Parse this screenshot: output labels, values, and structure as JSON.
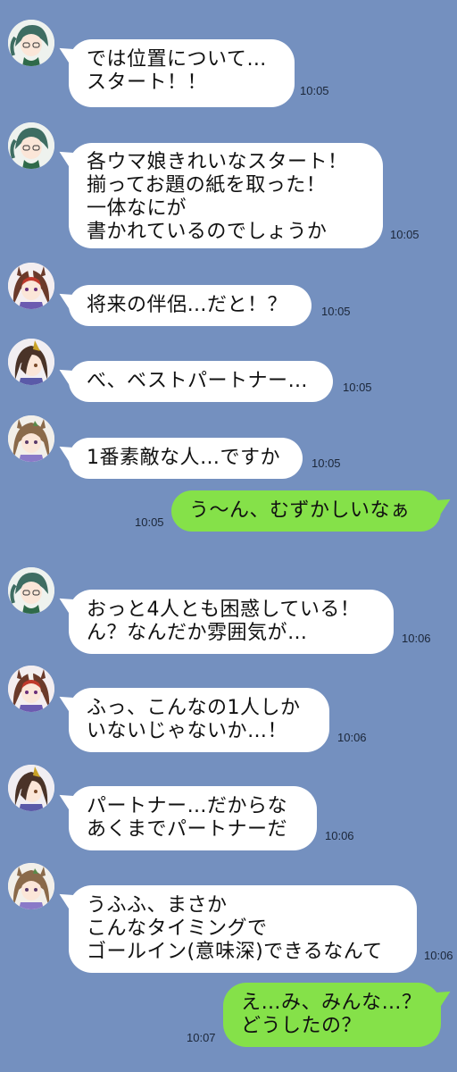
{
  "theme": {
    "background": "#7490bf",
    "incoming_bubble": "#ffffff",
    "outgoing_bubble": "#85e149"
  },
  "messages": [
    {
      "sender": "green-hair-glasses-avatar",
      "direction": "in",
      "text": "では位置について…\nスタート！！",
      "time": "10:05"
    },
    {
      "sender": "green-hair-glasses-avatar",
      "direction": "in",
      "text": "各ウマ娘きれいなスタート！\n揃ってお題の紙を取った！\n一体なにが\n書かれているのでしょうか",
      "time": "10:05"
    },
    {
      "sender": "red-streak-horse-girl-avatar",
      "direction": "in",
      "text": "将来の伴侶…だと！？",
      "time": "10:05"
    },
    {
      "sender": "brown-hair-horse-girl-avatar",
      "direction": "in",
      "text": "べ、ベストパートナー…",
      "time": "10:05"
    },
    {
      "sender": "long-hair-horse-girl-avatar",
      "direction": "in",
      "text": "1番素敵な人…ですか",
      "time": "10:05"
    },
    {
      "sender": "self",
      "direction": "out",
      "text": "う～ん、むずかしいなぁ",
      "time": "10:05"
    },
    {
      "sender": "green-hair-glasses-avatar",
      "direction": "in",
      "text": "おっと4人とも困惑している！\nん？なんだか雰囲気が…",
      "time": "10:06"
    },
    {
      "sender": "red-streak-horse-girl-avatar",
      "direction": "in",
      "text": "ふっ、こんなの1人しか\nいないじゃないか…！",
      "time": "10:06"
    },
    {
      "sender": "brown-hair-horse-girl-avatar",
      "direction": "in",
      "text": "パートナー…だからな\nあくまでパートナーだ",
      "time": "10:06"
    },
    {
      "sender": "long-hair-horse-girl-avatar",
      "direction": "in",
      "text": "うふふ、まさか\nこんなタイミングで\nゴールイン(意味深)できるなんて",
      "time": "10:06"
    },
    {
      "sender": "self",
      "direction": "out",
      "text": "え…み、みんな…？\nどうしたの？",
      "time": "10:07"
    }
  ]
}
